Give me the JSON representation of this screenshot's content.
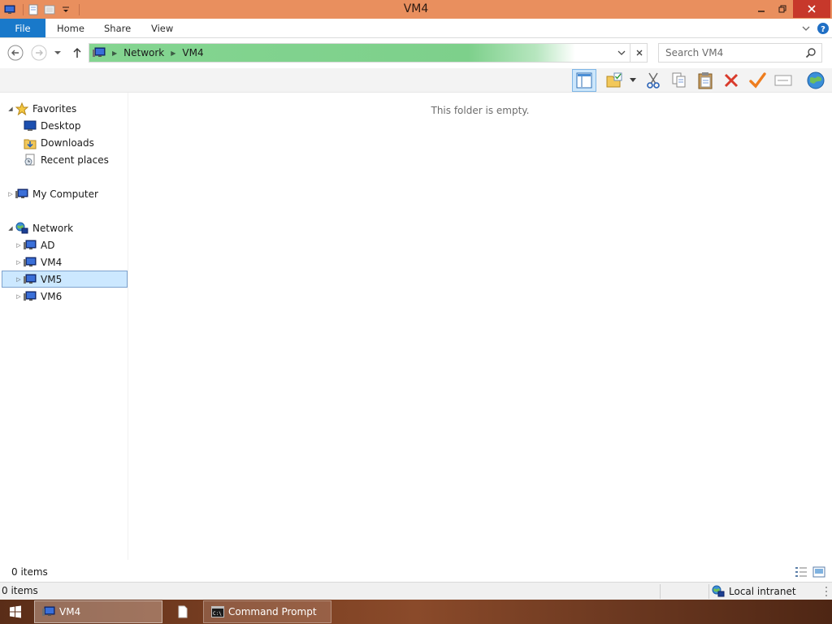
{
  "window": {
    "title": "VM4",
    "qat_icons": [
      "computer-icon",
      "properties-icon",
      "new-folder-icon",
      "customize-dropdown-icon"
    ],
    "controls": [
      "minimize-icon",
      "restore-icon",
      "close-icon"
    ]
  },
  "ribbon": {
    "tabs": [
      {
        "label": "File"
      },
      {
        "label": "Home"
      },
      {
        "label": "Share"
      },
      {
        "label": "View"
      }
    ],
    "right_icons": [
      "expand-ribbon-icon",
      "help-icon"
    ]
  },
  "address": {
    "crumbs": [
      "Network",
      "VM4"
    ],
    "search_placeholder": "Search VM4",
    "progress_color": "#7fd18b"
  },
  "toolbar": {
    "icons": [
      "preview-pane-icon",
      "folder-options-icon",
      "dropdown-icon",
      "cut-icon",
      "copy-icon",
      "paste-icon",
      "delete-icon",
      "checkmark-icon",
      "rename-icon",
      "globe-icon"
    ]
  },
  "nav": {
    "favorites": {
      "label": "Favorites",
      "items": [
        {
          "label": "Desktop"
        },
        {
          "label": "Downloads"
        },
        {
          "label": "Recent places"
        }
      ]
    },
    "computer": {
      "label": "My Computer"
    },
    "network": {
      "label": "Network",
      "items": [
        {
          "label": "AD"
        },
        {
          "label": "VM4"
        },
        {
          "label": "VM5",
          "selected": true
        },
        {
          "label": "VM6"
        }
      ]
    }
  },
  "content": {
    "empty_message": "This folder is empty."
  },
  "status": {
    "item_count": "0 items",
    "bottom_count": "0 items",
    "zone": "Local intranet"
  },
  "taskbar": {
    "items": [
      {
        "label": "VM4",
        "icon": "computer-icon",
        "active": true
      },
      {
        "label": "",
        "icon": "document-icon"
      },
      {
        "label": "Command Prompt",
        "icon": "cmd-icon"
      }
    ]
  },
  "colors": {
    "titlebar": "#e98f5e",
    "file_tab": "#1979ca",
    "close_button": "#c7382b",
    "selection": "#cce8ff"
  }
}
